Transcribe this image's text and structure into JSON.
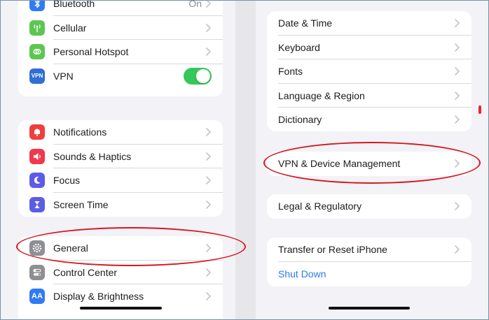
{
  "left_panel": {
    "group1": [
      {
        "label": "Bluetooth",
        "value": "On",
        "icon": "bluetooth-icon",
        "color": "#2f7bf5"
      },
      {
        "label": "Cellular",
        "icon": "cellular-antenna-icon",
        "color": "#5dc651"
      },
      {
        "label": "Personal Hotspot",
        "icon": "hotspot-link-icon",
        "color": "#5dc651"
      },
      {
        "label": "VPN",
        "icon": "vpn-badge-icon",
        "icon_text": "VPN",
        "color": "#2f6fd6",
        "toggle_on": true
      }
    ],
    "group2": [
      {
        "label": "Notifications",
        "icon": "bell-icon",
        "color": "#f03e3e"
      },
      {
        "label": "Sounds & Haptics",
        "icon": "speaker-icon",
        "color": "#f0384e"
      },
      {
        "label": "Focus",
        "icon": "moon-icon",
        "color": "#5d5ce6"
      },
      {
        "label": "Screen Time",
        "icon": "hourglass-icon",
        "color": "#5d5ce6"
      }
    ],
    "group3": [
      {
        "label": "General",
        "icon": "gear-icon",
        "color": "#8e8e93"
      },
      {
        "label": "Control Center",
        "icon": "toggles-icon",
        "color": "#8e8e93"
      },
      {
        "label": "Display & Brightness",
        "icon": "aa-text-icon",
        "icon_text": "AA",
        "color": "#2f7bf5"
      }
    ]
  },
  "right_panel": {
    "group1": [
      "Date & Time",
      "Keyboard",
      "Fonts",
      "Language & Region",
      "Dictionary"
    ],
    "group2": [
      "VPN & Device Management"
    ],
    "group3": [
      "Legal & Regulatory"
    ],
    "group4": {
      "transfer": "Transfer or Reset iPhone",
      "shutdown": "Shut Down"
    }
  },
  "colors": {
    "accent_link": "#2b7bef",
    "toggle_on": "#34c759",
    "annotation_red": "#d6171e",
    "chevron": "#c4c4c9"
  }
}
